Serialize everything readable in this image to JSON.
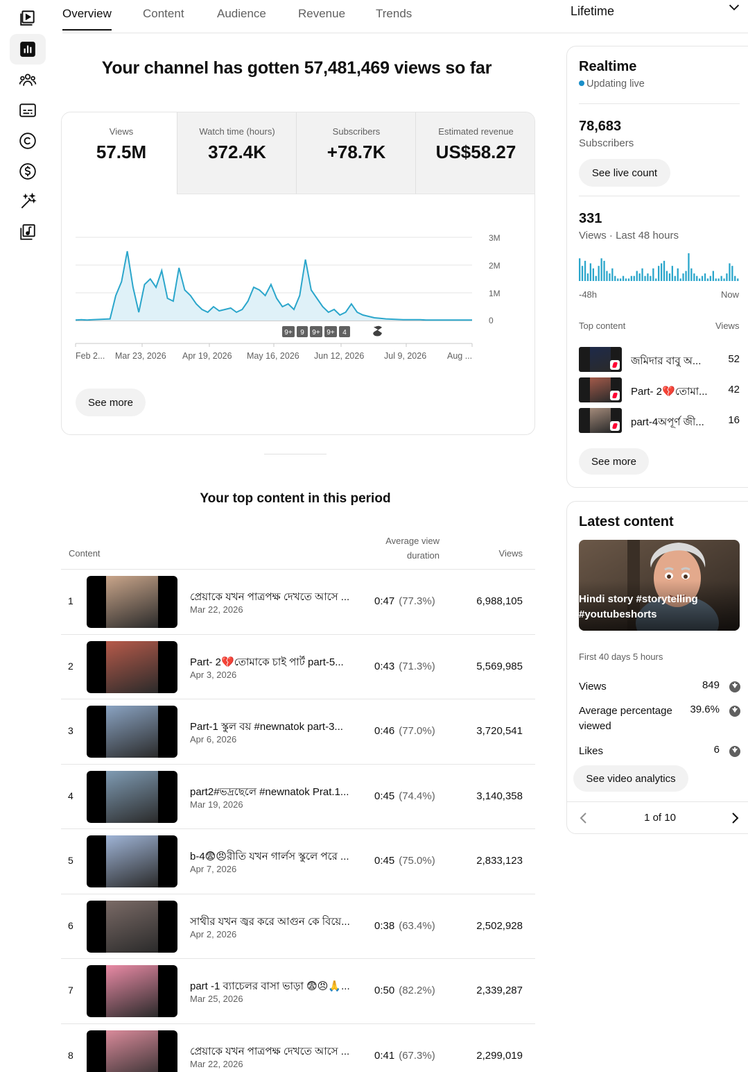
{
  "tabs": [
    "Overview",
    "Content",
    "Audience",
    "Revenue",
    "Trends"
  ],
  "period": "Lifetime",
  "headline": "Your channel has gotten 57,481,469 views so far",
  "metrics": [
    {
      "label": "Views",
      "value": "57.5M"
    },
    {
      "label": "Watch time (hours)",
      "value": "372.4K"
    },
    {
      "label": "Subscribers",
      "value": "+78.7K"
    },
    {
      "label": "Estimated revenue",
      "value": "US$58.27"
    }
  ],
  "chart_data": {
    "type": "area",
    "series": [
      {
        "values": [
          0.02,
          0.03,
          0.02,
          0.03,
          0.04,
          0.05,
          0.06,
          0.9,
          1.4,
          2.5,
          1.2,
          0.3,
          1.3,
          1.5,
          1.2,
          1.8,
          0.8,
          0.7,
          1.9,
          1.1,
          0.9,
          0.6,
          0.4,
          0.3,
          0.5,
          0.35,
          0.4,
          0.45,
          0.3,
          0.4,
          0.7,
          1.2,
          1.1,
          0.9,
          1.3,
          0.8,
          0.5,
          0.6,
          0.4,
          0.9,
          2.2,
          1.1,
          0.8,
          0.5,
          0.3,
          0.4,
          0.2,
          0.3,
          0.6,
          0.3,
          0.2,
          0.15,
          0.1,
          0.08,
          0.06,
          0.05,
          0.04,
          0.03,
          0.03,
          0.03,
          0.03,
          0.02,
          0.02,
          0.02,
          0.02,
          0.02,
          0.02,
          0.02,
          0.02,
          0.02
        ]
      }
    ],
    "y_ticks": [
      "3M",
      "2M",
      "1M",
      "0"
    ],
    "x_ticks": [
      "Feb 2...",
      "Mar 23, 2026",
      "Apr 19, 2026",
      "May 16, 2026",
      "Jun 12, 2026",
      "Jul 9, 2026",
      "Aug ..."
    ],
    "ylim": [
      0,
      3
    ],
    "markers": [
      "9+",
      "9",
      "9+",
      "9+",
      "4"
    ]
  },
  "see_more": "See more",
  "top_content": {
    "title": "Your top content in this period",
    "col_content": "Content",
    "col_avg1": "Average view",
    "col_avg2": "duration",
    "col_views": "Views",
    "rows": [
      {
        "rank": "1",
        "title": "প্রেয়াকে যখন পাত্রপক্ষ দেখতে আসে ...",
        "date": "Mar 22, 2026",
        "dur": "0:47",
        "pct": "(77.3%)",
        "views": "6,988,105",
        "color": "#c9a58a"
      },
      {
        "rank": "2",
        "title": "Part- 2💔তোমাকে চাই পার্ট part-5...",
        "date": "Apr 3, 2026",
        "dur": "0:43",
        "pct": "(71.3%)",
        "views": "5,569,985",
        "color": "#b65a4a"
      },
      {
        "rank": "3",
        "title": "Part-1 স্কুল বয় #newnatok part-3...",
        "date": "Apr 6, 2026",
        "dur": "0:46",
        "pct": "(77.0%)",
        "views": "3,720,541",
        "color": "#8aa3c2"
      },
      {
        "rank": "4",
        "title": "part2#ভদ্রছেলে #newnatok Prat.1...",
        "date": "Mar 19, 2026",
        "dur": "0:45",
        "pct": "(74.4%)",
        "views": "3,140,358",
        "color": "#7f9bb3"
      },
      {
        "rank": "5",
        "title": "b-4😨😠রীতি যখন গার্লস স্কুলে পরে ...",
        "date": "Apr 7, 2026",
        "dur": "0:45",
        "pct": "(75.0%)",
        "views": "2,833,123",
        "color": "#9fb4d6"
      },
      {
        "rank": "6",
        "title": "সাথীর যখন জ্বর করে আগুন কে বিয়ে...",
        "date": "Apr 2, 2026",
        "dur": "0:38",
        "pct": "(63.4%)",
        "views": "2,502,928",
        "color": "#7a6a66"
      },
      {
        "rank": "7",
        "title": "part -1 ব্যাচেলর বাসা ভাড়া 😨😠🙏...",
        "date": "Mar 25, 2026",
        "dur": "0:50",
        "pct": "(82.2%)",
        "views": "2,339,287",
        "color": "#e98aa5"
      },
      {
        "rank": "8",
        "title": "প্রেয়াকে যখন পাত্রপক্ষ দেখতে আসে ...",
        "date": "Mar 22, 2026",
        "dur": "0:41",
        "pct": "(67.3%)",
        "views": "2,299,019",
        "color": "#d98a9a"
      }
    ]
  },
  "realtime": {
    "title": "Realtime",
    "status": "Updating live",
    "subs_value": "78,683",
    "subs_label": "Subscribers",
    "see_live": "See live count",
    "views_value": "331",
    "views_label": "Views · Last 48 hours",
    "axis_left": "-48h",
    "axis_right": "Now",
    "top_content_label": "Top content",
    "views_col": "Views",
    "bars": [
      9,
      6,
      8,
      3,
      7,
      5,
      2,
      6,
      9,
      8,
      4,
      3,
      5,
      2,
      1,
      1,
      2,
      1,
      1,
      2,
      2,
      4,
      3,
      5,
      2,
      3,
      2,
      5,
      1,
      6,
      7,
      8,
      4,
      3,
      6,
      2,
      5,
      1,
      3,
      4,
      11,
      5,
      3,
      2,
      1,
      2,
      3,
      1,
      2,
      4,
      1,
      1,
      2,
      1,
      3,
      7,
      6,
      2,
      1
    ],
    "top_items": [
      {
        "title": "জমিদার বাবু অ...",
        "views": "52",
        "color": "#1e2a4a"
      },
      {
        "title": "Part- 2💔তোমা...",
        "views": "42",
        "color": "#a35a4a"
      },
      {
        "title": "part-4অপূর্ণ জী...",
        "views": "16",
        "color": "#a38a7a"
      }
    ],
    "see_more": "See more"
  },
  "latest": {
    "title": "Latest content",
    "caption": "Hindi story #storytelling #youtubeshorts",
    "period": "First 40 days 5 hours",
    "stats": [
      {
        "label": "Views",
        "value": "849"
      },
      {
        "label": "Average percentage viewed",
        "value": "39.6%"
      },
      {
        "label": "Likes",
        "value": "6"
      }
    ],
    "button": "See video analytics",
    "pager": "1 of 10"
  }
}
